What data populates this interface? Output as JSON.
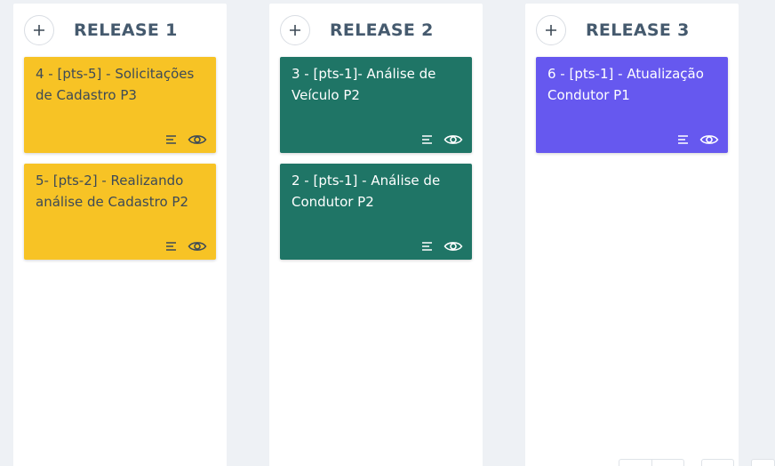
{
  "board": {
    "columns": [
      {
        "title": "RELEASE 1",
        "cards": [
          {
            "title": "4 - [pts-5] - Solicitações de Cadastro P3",
            "color": "#f7c325"
          },
          {
            "title": "5- [pts-2] - Realizando análise de Cadastro P2",
            "color": "#f7c325"
          }
        ]
      },
      {
        "title": "RELEASE 2",
        "cards": [
          {
            "title": "3 - [pts-1]- Análise de Veículo P2",
            "color": "#1f7566"
          },
          {
            "title": "2 - [pts-1] - Análise de Condutor P2",
            "color": "#1f7566"
          }
        ]
      },
      {
        "title": "RELEASE 3",
        "cards": [
          {
            "title": "6 - [pts-1] - Atualização Condutor P1",
            "color": "#6658ef"
          }
        ]
      }
    ]
  },
  "icons": {
    "add": "plus-icon",
    "description": "text-lines-icon",
    "watch": "eye-icon"
  },
  "colors": {
    "background": "#eef1f5",
    "column": "#ffffff",
    "header_text": "#455a6e"
  }
}
